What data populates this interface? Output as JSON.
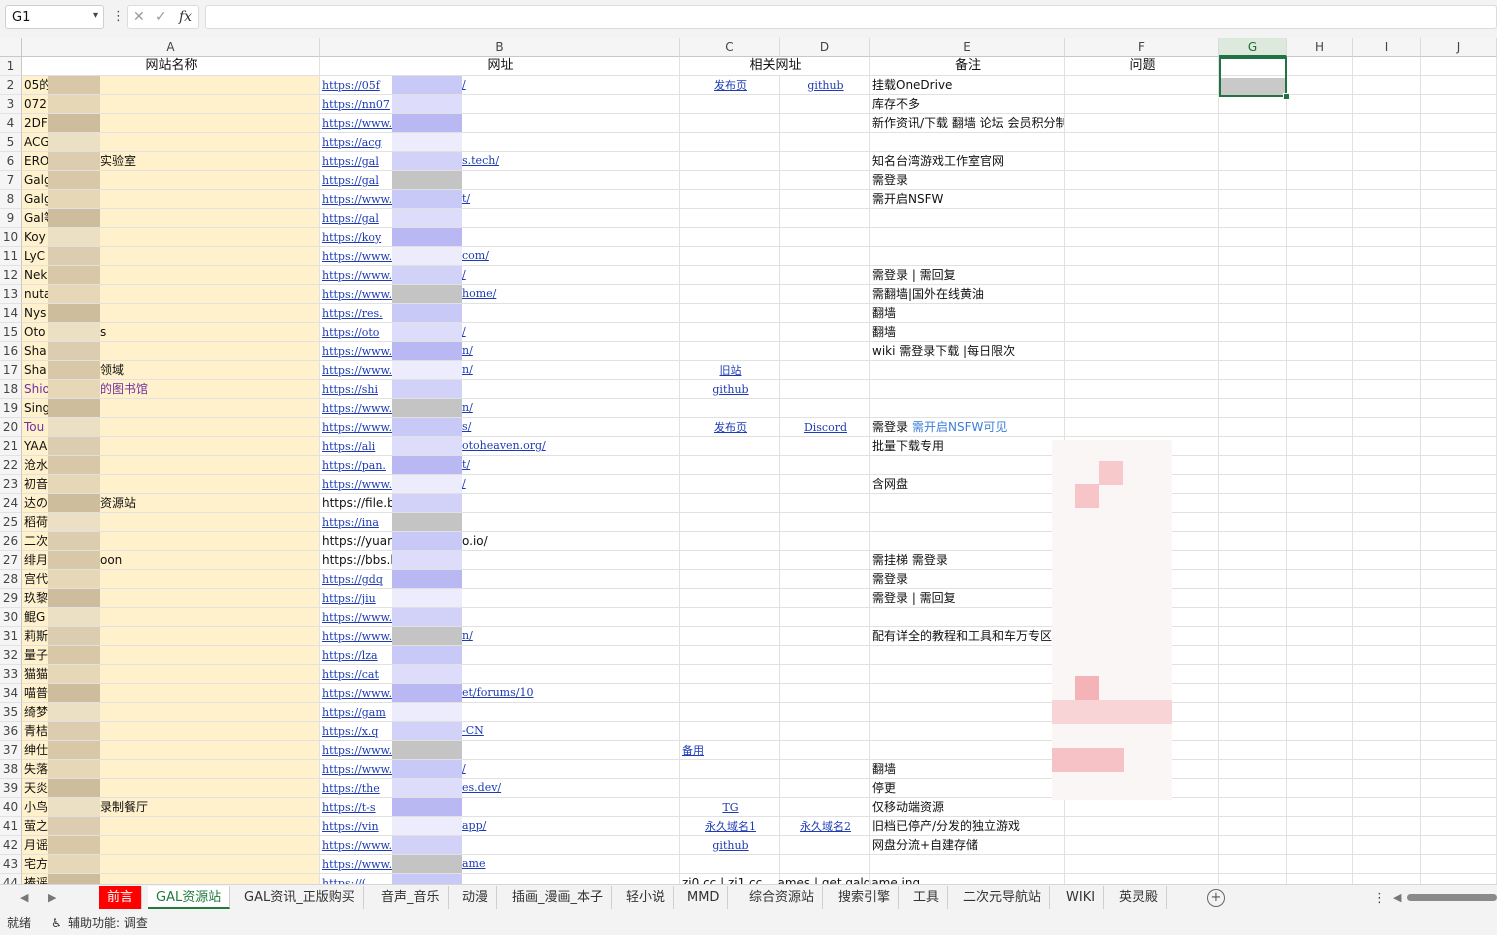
{
  "formula_bar": {
    "name_box": "G1",
    "fx": "fx",
    "cancel": "✕",
    "confirm": "✓",
    "formula": ""
  },
  "columns": [
    "A",
    "B",
    "C",
    "D",
    "E",
    "F",
    "G",
    "H",
    "I",
    "J"
  ],
  "header_row": {
    "A": "网站名称",
    "B": "网址",
    "CD": "相关网址",
    "E": "备注",
    "F": "问题"
  },
  "rows": [
    {
      "n": "2",
      "a": "05的",
      "a2": "",
      "b": "https://05f",
      "b2": "/",
      "c": "发布页",
      "d": "github",
      "e": "挂载OneDrive"
    },
    {
      "n": "3",
      "a": "0727",
      "a2": "",
      "b": "https://nn07",
      "b2": "",
      "c": "",
      "d": "",
      "e": "库存不多"
    },
    {
      "n": "4",
      "a": "2DF",
      "a2": "",
      "b": "https://www.",
      "b2": "",
      "c": "",
      "d": "",
      "e": "新作资讯/下载 翻墙 论坛 会员积分制"
    },
    {
      "n": "5",
      "a": "ACG",
      "a2": "",
      "b": "https://acg",
      "b2": "",
      "c": "",
      "d": "",
      "e": ""
    },
    {
      "n": "6",
      "a": "ERO",
      "a2": "实验室",
      "b": "https://gal",
      "b2": "s.tech/",
      "c": "",
      "d": "",
      "e": "知名台湾游戏工作室官网"
    },
    {
      "n": "7",
      "a": "Galg",
      "a2": "",
      "b": "https://gal",
      "b2": "",
      "c": "",
      "d": "",
      "e": "需登录"
    },
    {
      "n": "8",
      "a": "Galg",
      "a2": "",
      "b": "https://www.",
      "b2": "t/",
      "c": "",
      "d": "",
      "e": "需开启NSFW"
    },
    {
      "n": "9",
      "a": "Gal等",
      "a2": "",
      "b": "https://gal",
      "b2": "",
      "c": "",
      "d": "",
      "e": ""
    },
    {
      "n": "10",
      "a": "Koy",
      "a2": "",
      "b": "https://koy",
      "b2": "",
      "c": "",
      "d": "",
      "e": ""
    },
    {
      "n": "11",
      "a": "LyC",
      "a2": "",
      "b": "https://www.",
      "b2": "com/",
      "c": "",
      "d": "",
      "e": ""
    },
    {
      "n": "12",
      "a": "Nek",
      "a2": "",
      "b": "https://www.",
      "b2": "/",
      "c": "",
      "d": "",
      "e": "需登录 | 需回复"
    },
    {
      "n": "13",
      "a": "nuta",
      "a2": "",
      "b": "https://www.",
      "b2": "home/",
      "c": "",
      "d": "",
      "e": "需翻墙|国外在线黄油"
    },
    {
      "n": "14",
      "a": "Nys",
      "a2": "",
      "b": "https://res.",
      "b2": "",
      "c": "",
      "d": "",
      "e": "翻墙"
    },
    {
      "n": "15",
      "a": "Oto",
      "a2": "s",
      "b": "https://oto",
      "b2": "/",
      "c": "",
      "d": "",
      "e": "翻墙"
    },
    {
      "n": "16",
      "a": "Sha",
      "a2": "",
      "b": "https://www.",
      "b2": "n/",
      "c": "",
      "d": "",
      "e": "wiki 需登录下载 |每日限次"
    },
    {
      "n": "17",
      "a": "Sha",
      "a2": "领域",
      "b": "https://www.",
      "b2": "n/",
      "c": "旧站",
      "d": "",
      "e": ""
    },
    {
      "n": "18",
      "a": "Shio",
      "a2": "的图书馆",
      "b": "https://shi",
      "b2": "",
      "c": "github",
      "d": "",
      "e": ""
    },
    {
      "n": "19",
      "a": "Sing",
      "a2": "",
      "b": "https://www.",
      "b2": "n/",
      "c": "",
      "d": "",
      "e": ""
    },
    {
      "n": "20",
      "a": "Tou",
      "a2": "",
      "b": "https://www.",
      "b2": "s/",
      "c": "发布页",
      "d": "Discord",
      "e": "需登录",
      "e2": "需开启NSFW可见"
    },
    {
      "n": "21",
      "a": "YAA",
      "a2": "",
      "b": "https://ali",
      "b2": "otoheaven.org/",
      "c": "",
      "d": "",
      "e": "批量下载专用"
    },
    {
      "n": "22",
      "a": "沧水",
      "a2": "",
      "b": "https://pan.",
      "b2": "t/",
      "c": "",
      "d": "",
      "e": ""
    },
    {
      "n": "23",
      "a": "初音",
      "a2": "",
      "b": "https://www.",
      "b2": "/",
      "c": "",
      "d": "",
      "e": "含网盘"
    },
    {
      "n": "24",
      "a": "达の",
      "a2": "资源站",
      "b": "https://file.b",
      "b2": "",
      "c": "",
      "d": "",
      "e": ""
    },
    {
      "n": "25",
      "a": "稻荷",
      "a2": "",
      "b": "https://ina",
      "b2": "",
      "c": "",
      "d": "",
      "e": ""
    },
    {
      "n": "26",
      "a": "二次",
      "a2": "",
      "b": "https://yuan",
      "b2": "o.io/",
      "c": "",
      "d": "",
      "e": ""
    },
    {
      "n": "27",
      "a": "绯月",
      "a2": "oon",
      "b": "https://bbs.l",
      "b2": "",
      "c": "",
      "d": "",
      "e": "需挂梯 需登录"
    },
    {
      "n": "28",
      "a": "宫代",
      "a2": "",
      "b": "https://gdq",
      "b2": "",
      "c": "",
      "d": "",
      "e": "需登录"
    },
    {
      "n": "29",
      "a": "玖黎",
      "a2": "",
      "b": "https://jiu",
      "b2": "",
      "c": "",
      "d": "",
      "e": "需登录 | 需回复"
    },
    {
      "n": "30",
      "a": "鲲G",
      "a2": "",
      "b": "https://www.",
      "b2": "",
      "c": "",
      "d": "",
      "e": ""
    },
    {
      "n": "31",
      "a": "莉斯",
      "a2": "",
      "b": "https://www.",
      "b2": "n/",
      "c": "",
      "d": "",
      "e": "配有详全的教程和工具和车万专区"
    },
    {
      "n": "32",
      "a": "量子",
      "a2": "",
      "b": "https://lza",
      "b2": "",
      "c": "",
      "d": "",
      "e": ""
    },
    {
      "n": "33",
      "a": "猫猫",
      "a2": "",
      "b": "https://cat",
      "b2": "",
      "c": "",
      "d": "",
      "e": ""
    },
    {
      "n": "34",
      "a": "喵普",
      "a2": "",
      "b": "https://www.",
      "b2": "et/forums/10",
      "c": "",
      "d": "",
      "e": ""
    },
    {
      "n": "35",
      "a": "绮梦",
      "a2": "",
      "b": "https://gam",
      "b2": "",
      "c": "",
      "d": "",
      "e": ""
    },
    {
      "n": "36",
      "a": "青桔",
      "a2": "",
      "b": "https://x.q",
      "b2": "-CN",
      "c": "",
      "d": "",
      "e": ""
    },
    {
      "n": "37",
      "a": "绅仕",
      "a2": "",
      "b": "https://www.",
      "b2": "",
      "c": "备用",
      "d": "",
      "e": ""
    },
    {
      "n": "38",
      "a": "失落",
      "a2": "",
      "b": "https://www.",
      "b2": "/",
      "c": "",
      "d": "",
      "e": "翻墙"
    },
    {
      "n": "39",
      "a": "天炎",
      "a2": "",
      "b": "https://the",
      "b2": "es.dev/",
      "c": "",
      "d": "",
      "e": "停更"
    },
    {
      "n": "40",
      "a": "小鸟",
      "a2": "录制餐厅",
      "b": "https://t-s",
      "b2": "",
      "c": "TG",
      "d": "",
      "e": "仅移动端资源"
    },
    {
      "n": "41",
      "a": "萤之",
      "a2": "",
      "b": "https://vin",
      "b2": "app/",
      "c": "永久域名1",
      "d": "永久域名2",
      "e": "旧档已停产/分发的独立游戏"
    },
    {
      "n": "42",
      "a": "月谣",
      "a2": "",
      "b": "https://www.",
      "b2": "",
      "c": "github",
      "d": "",
      "e": "网盘分流+自建存储"
    },
    {
      "n": "43",
      "a": "宅方",
      "a2": "",
      "b": "https://www.",
      "b2": "ame",
      "c": "",
      "d": "",
      "e": ""
    },
    {
      "n": "44",
      "a": "捧谣",
      "a2": "",
      "b": "https://(",
      "b2": "",
      "c": "zi0.cc | zi1.cc ...ames | get.galgame.ing",
      "d": "",
      "e": ""
    }
  ],
  "sheet_tabs": [
    "前言",
    "GAL资源站",
    "GAL资讯_正版购买",
    "音声_音乐",
    "动漫",
    "插画_漫画_本子",
    "轻小说",
    "MMD",
    "综合资源站",
    "搜索引擎",
    "工具",
    "二次元导航站",
    "WIKI",
    "英灵殿"
  ],
  "tab_add": "+",
  "status": {
    "ready": "就绪",
    "accessibility": "辅助功能: 调查"
  },
  "colors": {
    "accent": "#217346",
    "name_col_fill": "#fff1cc",
    "link": "#1d3bb3",
    "red_tab": "#ff0000"
  }
}
